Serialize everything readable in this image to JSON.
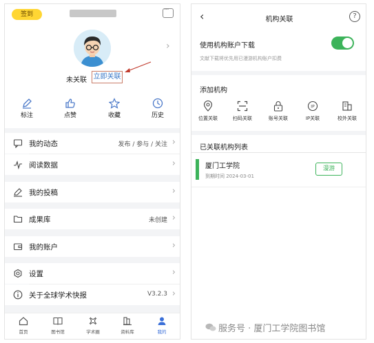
{
  "left": {
    "signin_badge": "签到",
    "unlinked_label": "未关联",
    "link_now_button": "立即关联",
    "quick_actions": [
      {
        "label": "标注",
        "icon": "pen-icon"
      },
      {
        "label": "点赞",
        "icon": "thumbs-up-icon"
      },
      {
        "label": "收藏",
        "icon": "star-icon"
      },
      {
        "label": "历史",
        "icon": "clock-icon"
      }
    ],
    "menu": [
      {
        "label": "我的动态",
        "right": "发布 / 参与 / 关注",
        "icon": "message-icon"
      },
      {
        "label": "阅读数据",
        "right": "",
        "icon": "activity-icon"
      },
      {
        "label": "我的投稿",
        "right": "",
        "icon": "edit-icon"
      },
      {
        "label": "成果库",
        "right": "未创建",
        "icon": "folder-icon"
      },
      {
        "label": "我的账户",
        "right": "",
        "icon": "wallet-icon"
      },
      {
        "label": "设置",
        "right": "",
        "icon": "gear-icon"
      },
      {
        "label": "关于全球学术快报",
        "right": "V3.2.3",
        "icon": "info-icon"
      }
    ],
    "tabs": [
      {
        "label": "首页",
        "icon": "home-icon"
      },
      {
        "label": "图书馆",
        "icon": "book-icon"
      },
      {
        "label": "学术圈",
        "icon": "circle-nodes-icon"
      },
      {
        "label": "资料库",
        "icon": "library-icon"
      },
      {
        "label": "我的",
        "icon": "person-icon"
      }
    ],
    "active_tab_color": "#3a6fd8"
  },
  "right": {
    "title": "机构关联",
    "use_account_label": "使用机构账户下载",
    "use_account_note": "文献下载将优先用已漫游机构账户扣费",
    "use_account_enabled": true,
    "add_label": "添加机构",
    "options": [
      {
        "label": "位置关联",
        "icon": "location-icon"
      },
      {
        "label": "扫码关联",
        "icon": "scan-icon"
      },
      {
        "label": "账号关联",
        "icon": "lock-icon"
      },
      {
        "label": "IP关联",
        "icon": "ip-icon"
      },
      {
        "label": "校外关联",
        "icon": "building-icon"
      }
    ],
    "linked_list_label": "已关联机构列表",
    "institution": {
      "name": "厦门工学院",
      "expiry": "到期时间 2024-03-01",
      "roam_button": "漫游"
    },
    "accent_color": "#3cb35a"
  },
  "watermark": "服务号 · 厦门工学院图书馆"
}
